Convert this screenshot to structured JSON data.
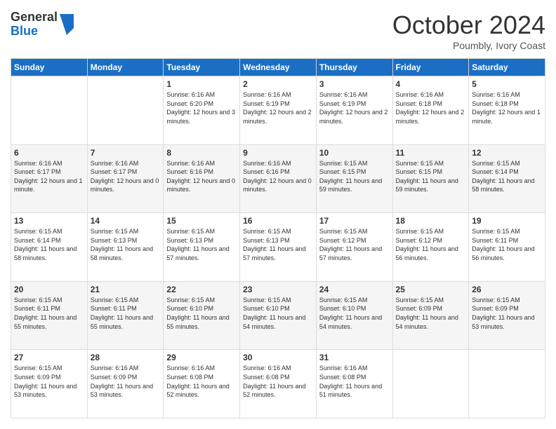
{
  "logo": {
    "line1": "General",
    "line2": "Blue"
  },
  "title": "October 2024",
  "location": "Poumbly, Ivory Coast",
  "days_header": [
    "Sunday",
    "Monday",
    "Tuesday",
    "Wednesday",
    "Thursday",
    "Friday",
    "Saturday"
  ],
  "weeks": [
    [
      {
        "day": "",
        "info": ""
      },
      {
        "day": "",
        "info": ""
      },
      {
        "day": "1",
        "info": "Sunrise: 6:16 AM\nSunset: 6:20 PM\nDaylight: 12 hours and 3 minutes."
      },
      {
        "day": "2",
        "info": "Sunrise: 6:16 AM\nSunset: 6:19 PM\nDaylight: 12 hours and 2 minutes."
      },
      {
        "day": "3",
        "info": "Sunrise: 6:16 AM\nSunset: 6:19 PM\nDaylight: 12 hours and 2 minutes."
      },
      {
        "day": "4",
        "info": "Sunrise: 6:16 AM\nSunset: 6:18 PM\nDaylight: 12 hours and 2 minutes."
      },
      {
        "day": "5",
        "info": "Sunrise: 6:16 AM\nSunset: 6:18 PM\nDaylight: 12 hours and 1 minute."
      }
    ],
    [
      {
        "day": "6",
        "info": "Sunrise: 6:16 AM\nSunset: 6:17 PM\nDaylight: 12 hours and 1 minute."
      },
      {
        "day": "7",
        "info": "Sunrise: 6:16 AM\nSunset: 6:17 PM\nDaylight: 12 hours and 0 minutes."
      },
      {
        "day": "8",
        "info": "Sunrise: 6:16 AM\nSunset: 6:16 PM\nDaylight: 12 hours and 0 minutes."
      },
      {
        "day": "9",
        "info": "Sunrise: 6:16 AM\nSunset: 6:16 PM\nDaylight: 12 hours and 0 minutes."
      },
      {
        "day": "10",
        "info": "Sunrise: 6:15 AM\nSunset: 6:15 PM\nDaylight: 11 hours and 59 minutes."
      },
      {
        "day": "11",
        "info": "Sunrise: 6:15 AM\nSunset: 6:15 PM\nDaylight: 11 hours and 59 minutes."
      },
      {
        "day": "12",
        "info": "Sunrise: 6:15 AM\nSunset: 6:14 PM\nDaylight: 11 hours and 58 minutes."
      }
    ],
    [
      {
        "day": "13",
        "info": "Sunrise: 6:15 AM\nSunset: 6:14 PM\nDaylight: 11 hours and 58 minutes."
      },
      {
        "day": "14",
        "info": "Sunrise: 6:15 AM\nSunset: 6:13 PM\nDaylight: 11 hours and 58 minutes."
      },
      {
        "day": "15",
        "info": "Sunrise: 6:15 AM\nSunset: 6:13 PM\nDaylight: 11 hours and 57 minutes."
      },
      {
        "day": "16",
        "info": "Sunrise: 6:15 AM\nSunset: 6:13 PM\nDaylight: 11 hours and 57 minutes."
      },
      {
        "day": "17",
        "info": "Sunrise: 6:15 AM\nSunset: 6:12 PM\nDaylight: 11 hours and 57 minutes."
      },
      {
        "day": "18",
        "info": "Sunrise: 6:15 AM\nSunset: 6:12 PM\nDaylight: 11 hours and 56 minutes."
      },
      {
        "day": "19",
        "info": "Sunrise: 6:15 AM\nSunset: 6:11 PM\nDaylight: 11 hours and 56 minutes."
      }
    ],
    [
      {
        "day": "20",
        "info": "Sunrise: 6:15 AM\nSunset: 6:11 PM\nDaylight: 11 hours and 55 minutes."
      },
      {
        "day": "21",
        "info": "Sunrise: 6:15 AM\nSunset: 6:11 PM\nDaylight: 11 hours and 55 minutes."
      },
      {
        "day": "22",
        "info": "Sunrise: 6:15 AM\nSunset: 6:10 PM\nDaylight: 11 hours and 55 minutes."
      },
      {
        "day": "23",
        "info": "Sunrise: 6:15 AM\nSunset: 6:10 PM\nDaylight: 11 hours and 54 minutes."
      },
      {
        "day": "24",
        "info": "Sunrise: 6:15 AM\nSunset: 6:10 PM\nDaylight: 11 hours and 54 minutes."
      },
      {
        "day": "25",
        "info": "Sunrise: 6:15 AM\nSunset: 6:09 PM\nDaylight: 11 hours and 54 minutes."
      },
      {
        "day": "26",
        "info": "Sunrise: 6:15 AM\nSunset: 6:09 PM\nDaylight: 11 hours and 53 minutes."
      }
    ],
    [
      {
        "day": "27",
        "info": "Sunrise: 6:15 AM\nSunset: 6:09 PM\nDaylight: 11 hours and 53 minutes."
      },
      {
        "day": "28",
        "info": "Sunrise: 6:16 AM\nSunset: 6:09 PM\nDaylight: 11 hours and 53 minutes."
      },
      {
        "day": "29",
        "info": "Sunrise: 6:16 AM\nSunset: 6:08 PM\nDaylight: 11 hours and 52 minutes."
      },
      {
        "day": "30",
        "info": "Sunrise: 6:16 AM\nSunset: 6:08 PM\nDaylight: 11 hours and 52 minutes."
      },
      {
        "day": "31",
        "info": "Sunrise: 6:16 AM\nSunset: 6:08 PM\nDaylight: 11 hours and 51 minutes."
      },
      {
        "day": "",
        "info": ""
      },
      {
        "day": "",
        "info": ""
      }
    ]
  ]
}
